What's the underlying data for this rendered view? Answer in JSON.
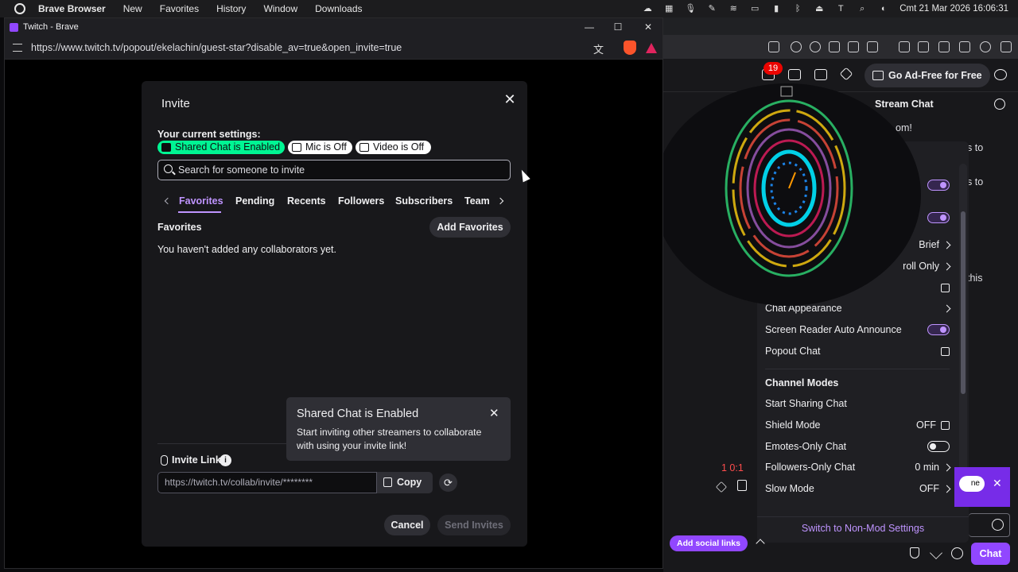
{
  "menubar": {
    "items": [
      "Brave Browser",
      "New",
      "Favorites",
      "History",
      "Window",
      "Downloads"
    ],
    "clock": "Cmt 21 Mar 2026 16:06:31"
  },
  "popout_window": {
    "title": "Twitch - Brave",
    "url": "https://www.twitch.tv/popout/ekelachin/guest-star?disable_av=true&open_invite=true"
  },
  "invite_modal": {
    "title": "Invite",
    "current_settings_label": "Your current settings:",
    "chips": {
      "shared": "Shared Chat is Enabled",
      "mic": "Mic is Off",
      "video": "Video is Off"
    },
    "search_placeholder": "Search for someone to invite",
    "tabs": [
      "Favorites",
      "Pending",
      "Recents",
      "Followers",
      "Subscribers",
      "Team"
    ],
    "active_tab": "Favorites",
    "section_heading": "Favorites",
    "add_favorites": "Add Favorites",
    "empty_message": "You haven't added any collaborators yet.",
    "tooltip": {
      "title": "Shared Chat is Enabled",
      "body": "Start inviting other streamers to collaborate with using your invite link!"
    },
    "invite_link_label": "Invite Link",
    "invite_link_value": "https://twitch.tv/collab/invite/********",
    "copy": "Copy",
    "cancel": "Cancel",
    "send": "Send Invites"
  },
  "twitch": {
    "notification_count": "19",
    "go_ad_free": "Go Ad-Free for Free",
    "stream_chat": "Stream Chat",
    "welcome_partial": "om!",
    "side_fragments": [
      "s to",
      "s to",
      "this"
    ],
    "chat_settings": {
      "partial_rows": [
        {
          "label": "Brief",
          "kind": "chevron"
        },
        {
          "label": "roll Only",
          "kind": "chevron"
        }
      ],
      "rows": [
        {
          "label": "Chat Appearance",
          "kind": "chevron",
          "value": ""
        },
        {
          "label": "Screen Reader Auto Announce",
          "kind": "toggle-on",
          "value": ""
        },
        {
          "label": "Popout Chat",
          "kind": "external",
          "value": ""
        }
      ],
      "channel_modes_heading": "Channel Modes",
      "mode_rows": [
        {
          "label": "Start Sharing Chat",
          "kind": "none",
          "value": ""
        },
        {
          "label": "Shield Mode",
          "kind": "external",
          "value": "OFF"
        },
        {
          "label": "Emotes-Only Chat",
          "kind": "toggle-off",
          "value": ""
        },
        {
          "label": "Followers-Only Chat",
          "kind": "chevron",
          "value": "0 min"
        },
        {
          "label": "Slow Mode",
          "kind": "chevron",
          "value": "OFF"
        }
      ],
      "switch_label": "Switch to Non-Mod Settings"
    },
    "viewer_count_partial": "1  0:1",
    "add_social_links": "Add social links",
    "chat_button": "Chat"
  }
}
